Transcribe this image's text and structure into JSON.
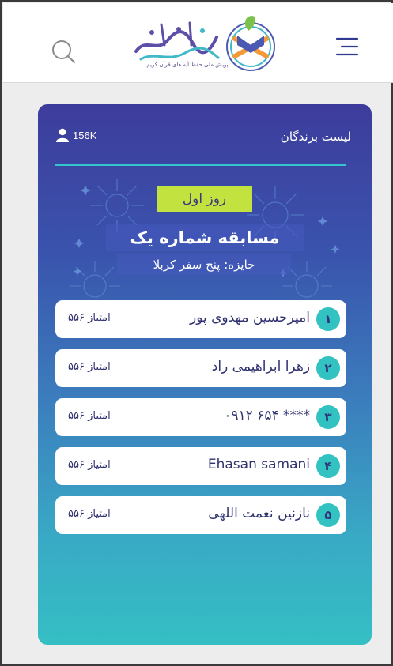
{
  "header": {
    "logo_tagline": "پویش ملی حفظ آیه های قرآن کریم",
    "logo_text": "زندگی با آیه‌ها"
  },
  "icons": {
    "search": "search-icon",
    "menu": "hamburger-menu-icon",
    "user": "user-icon",
    "logo": "quran-logo-icon"
  },
  "colors": {
    "card_top": "#3d3c9c",
    "card_bottom": "#35bfc4",
    "accent_teal": "#33c2c2",
    "badge_green": "#c2e23f",
    "text_dark": "#2f3170"
  },
  "winners_card": {
    "title": "لیست برندگان",
    "participant_count": "156K",
    "day_label": "روز اول",
    "contest_title": "مسابقه شماره یک",
    "prize": "جایزه: پنج سفر کربلا"
  },
  "winners": [
    {
      "rank": "۱",
      "name": "امیرحسین مهدوی پور",
      "score": "امتیاز ۵۵۶"
    },
    {
      "rank": "۲",
      "name": "زهرا ابراهیمی راد",
      "score": "امتیاز ۵۵۶"
    },
    {
      "rank": "۳",
      "name": "۰۹۱۲ ۶۵۴ ****",
      "score": "امتیاز ۵۵۶"
    },
    {
      "rank": "۴",
      "name": "Ehasan samani",
      "score": "امتیاز ۵۵۶"
    },
    {
      "rank": "۵",
      "name": "نازنین نعمت اللهی",
      "score": "امتیاز ۵۵۶"
    }
  ]
}
